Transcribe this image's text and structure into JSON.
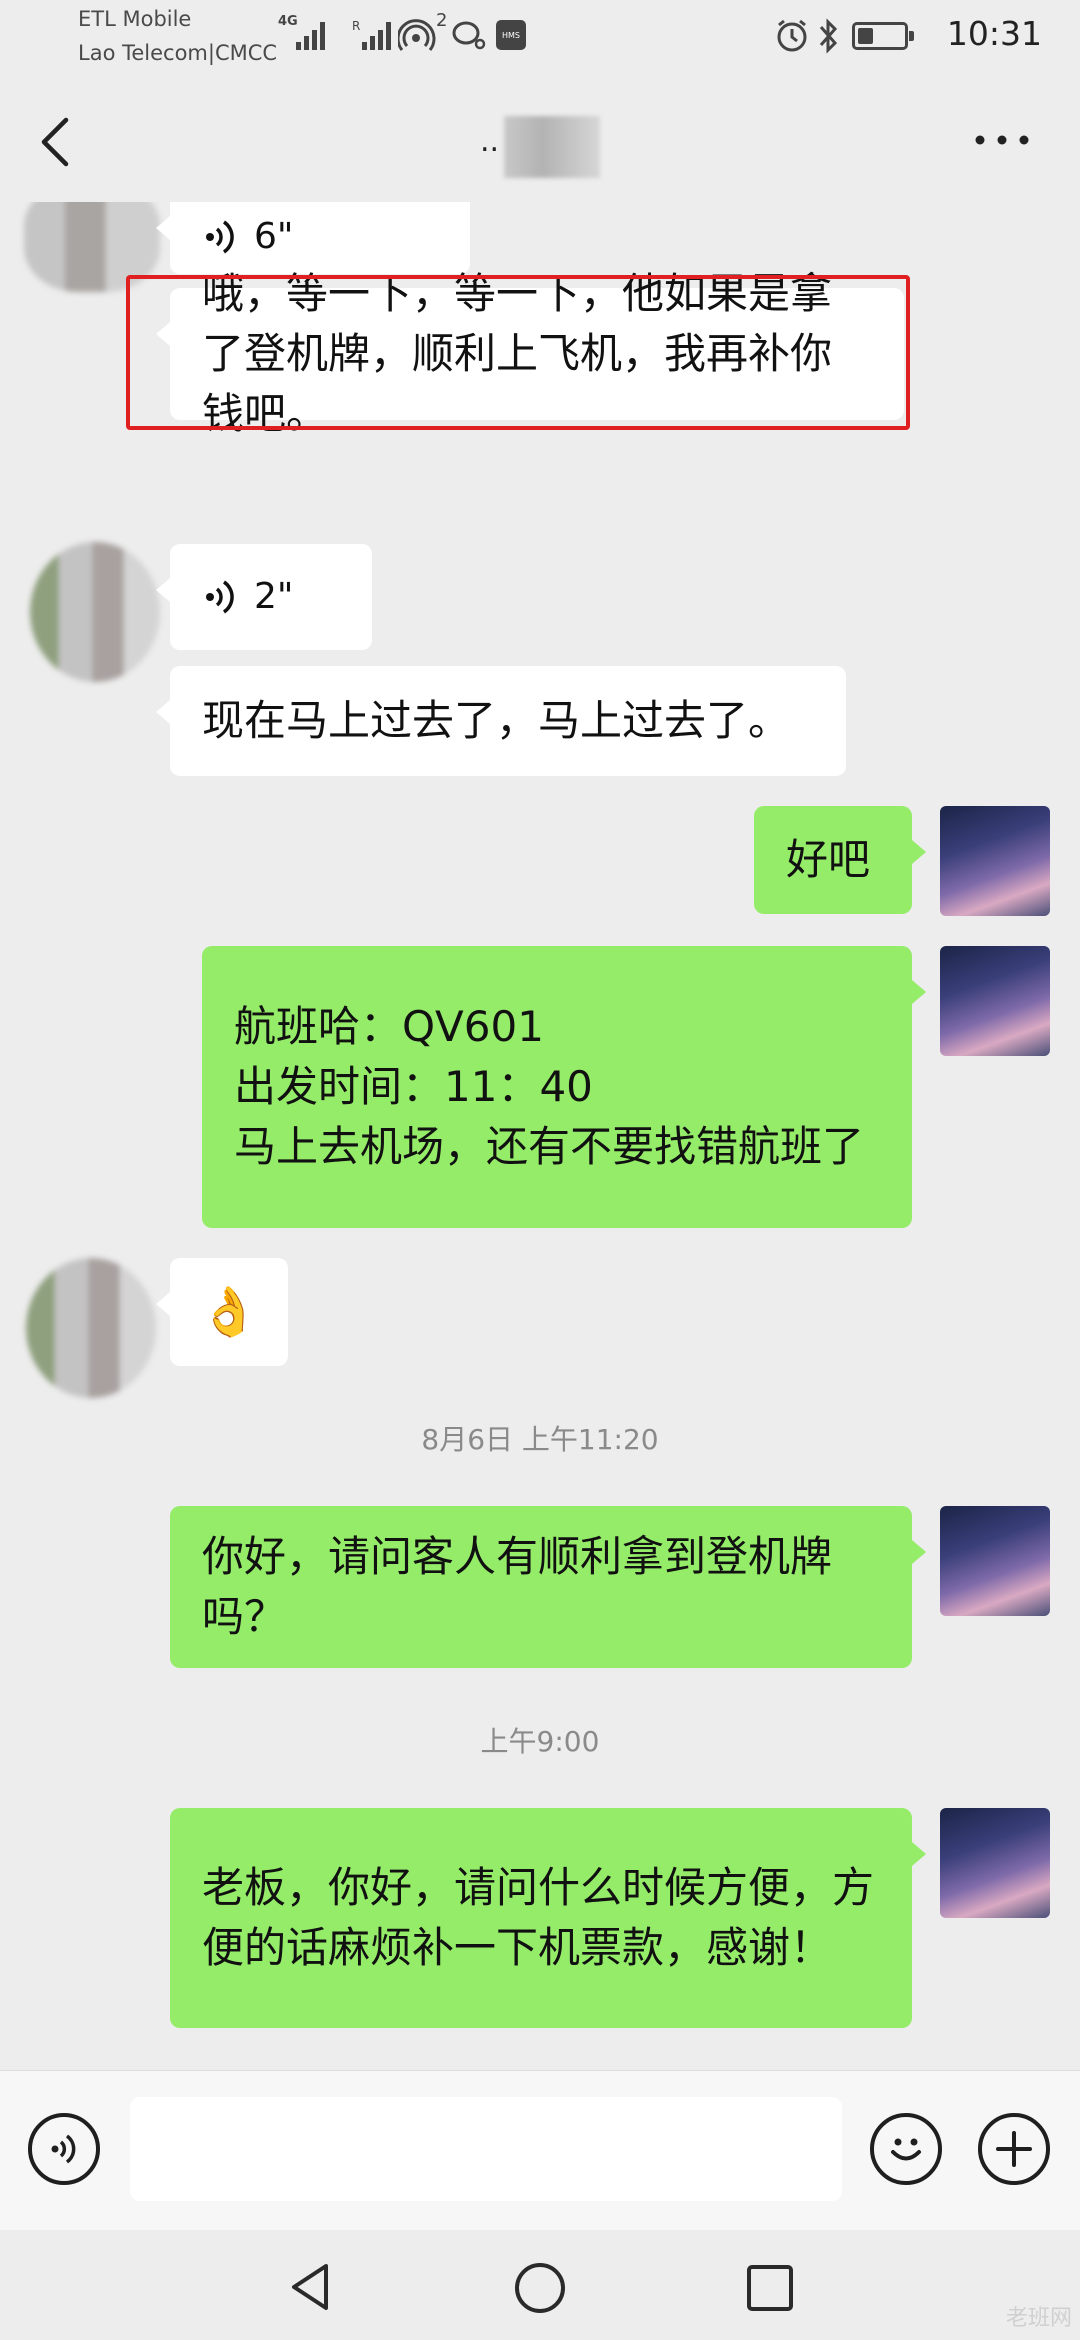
{
  "status_bar": {
    "carrier_line1": "ETL Mobile",
    "carrier_line2": "Lao Telecom|CMCC",
    "network_type": "4G",
    "hotspot_count": "2",
    "hms_label": "HMS",
    "time": "10:31",
    "battery_level": 0.3
  },
  "header": {
    "title": "..",
    "back_icon": "chevron-left-icon",
    "more_icon": "more-horizontal-icon"
  },
  "messages": [
    {
      "side": "left",
      "kind": "voice",
      "duration": "6\""
    },
    {
      "side": "left",
      "kind": "text",
      "text": "哦，等一下，等一下，他如果是拿了登机牌，顺利上飞机，我再补你钱吧。",
      "highlighted": true
    },
    {
      "side": "left",
      "kind": "voice",
      "duration": "2\""
    },
    {
      "side": "left",
      "kind": "text",
      "text": "现在马上过去了，马上过去了。"
    },
    {
      "side": "right",
      "kind": "text",
      "text": "好吧"
    },
    {
      "side": "right",
      "kind": "text",
      "text": "航班哈：QV601\n出发时间：11：40\n马上去机场，还有不要找错航班了"
    },
    {
      "side": "left",
      "kind": "emoji",
      "text": "👌"
    },
    {
      "kind": "timestamp",
      "text": "8月6日 上午11:20"
    },
    {
      "side": "right",
      "kind": "text",
      "text": "你好，请问客人有顺利拿到登机牌吗？"
    },
    {
      "kind": "timestamp",
      "text": "上午9:00"
    },
    {
      "side": "right",
      "kind": "text",
      "text": "老板，你好，请问什么时候方便，方便的话麻烦补一下机票款，感谢！"
    }
  ],
  "input_bar": {
    "voice_icon": "voice-input-icon",
    "input_value": "",
    "emoji_icon": "emoji-icon",
    "plus_icon": "plus-icon"
  },
  "nav_bar": {
    "back_icon": "nav-back-icon",
    "home_icon": "nav-home-icon",
    "recents_icon": "nav-recents-icon"
  },
  "colors": {
    "background": "#ededed",
    "bubble_sent": "#95ec69",
    "bubble_received": "#ffffff",
    "highlight_box": "#e02020"
  },
  "watermark": "老班网"
}
